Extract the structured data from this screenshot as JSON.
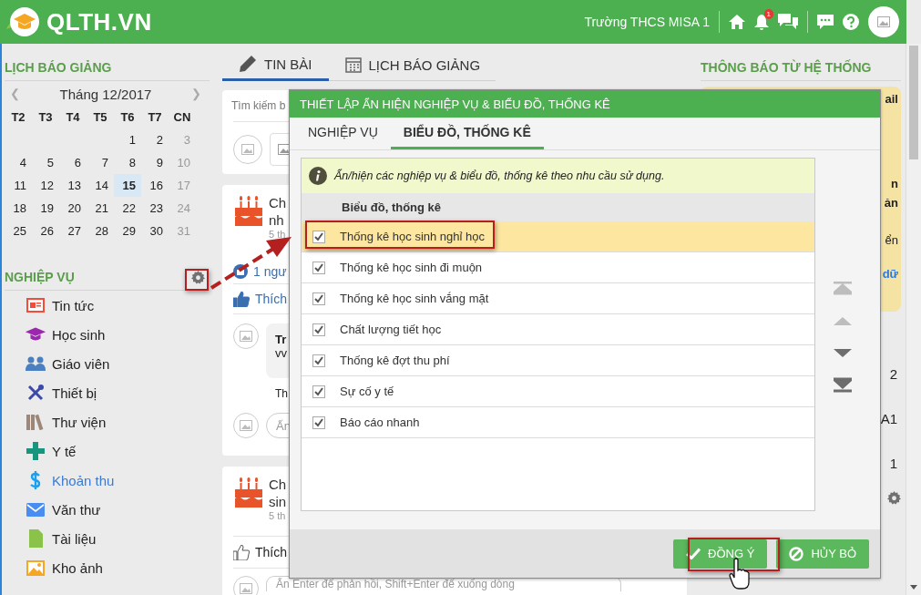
{
  "header": {
    "logo": "QLTH.VN",
    "school": "Trường THCS MISA 1",
    "badge": "1"
  },
  "calendar": {
    "title": "LỊCH BÁO GIẢNG",
    "month": "Tháng 12/2017",
    "prev": "❮",
    "next": "❯",
    "weekdays": [
      "T2",
      "T3",
      "T4",
      "T5",
      "T6",
      "T7",
      "CN"
    ],
    "weeks": [
      [
        {
          "day": "1",
          "selected": false
        },
        {
          "day": "2",
          "selected": false
        },
        {
          "day": "3",
          "selected": false
        }
      ],
      [
        {
          "day": "4",
          "selected": false
        },
        {
          "day": "5",
          "selected": false
        },
        {
          "day": "6",
          "selected": false
        },
        {
          "day": "7",
          "selected": false
        },
        {
          "day": "8",
          "selected": false
        },
        {
          "day": "9",
          "selected": false
        },
        {
          "day": "10",
          "selected": false
        }
      ],
      [
        {
          "day": "11",
          "selected": false
        },
        {
          "day": "12",
          "selected": false
        },
        {
          "day": "13",
          "selected": false
        },
        {
          "day": "14",
          "selected": false
        },
        {
          "day": "15",
          "selected": true
        },
        {
          "day": "16",
          "selected": false
        },
        {
          "day": "17",
          "selected": false
        }
      ],
      [
        {
          "day": "18",
          "selected": false
        },
        {
          "day": "19",
          "selected": false
        },
        {
          "day": "20",
          "selected": false
        },
        {
          "day": "21",
          "selected": false
        },
        {
          "day": "22",
          "selected": false
        },
        {
          "day": "23",
          "selected": false
        },
        {
          "day": "24",
          "selected": false
        }
      ],
      [
        {
          "day": "25",
          "selected": false
        },
        {
          "day": "26",
          "selected": false
        },
        {
          "day": "27",
          "selected": false
        },
        {
          "day": "28",
          "selected": false
        },
        {
          "day": "29",
          "selected": false
        },
        {
          "day": "30",
          "selected": false
        },
        {
          "day": "31",
          "selected": false
        }
      ]
    ]
  },
  "modules": {
    "title": "NGHIỆP VỤ",
    "items": [
      {
        "kind": "news",
        "label": "Tin tức",
        "selected": false
      },
      {
        "kind": "student",
        "label": "Học sinh",
        "selected": false
      },
      {
        "kind": "teacher",
        "label": "Giáo viên",
        "selected": false
      },
      {
        "kind": "equipment",
        "label": "Thiết bị",
        "selected": false
      },
      {
        "kind": "library",
        "label": "Thư viện",
        "selected": false
      },
      {
        "kind": "health",
        "label": "Y tế",
        "selected": false
      },
      {
        "kind": "fee",
        "label": "Khoản thu",
        "selected": true
      },
      {
        "kind": "mail",
        "label": "Văn thư",
        "selected": false
      },
      {
        "kind": "document",
        "label": "Tài liệu",
        "selected": false
      },
      {
        "kind": "photo",
        "label": "Kho ảnh",
        "selected": false
      }
    ]
  },
  "feed": {
    "tabs": [
      {
        "label": "TIN BÀI",
        "kind": "posts",
        "selected": true
      },
      {
        "label": "LỊCH BÁO GIẢNG",
        "kind": "calendar",
        "selected": false
      }
    ],
    "search": {
      "placeholder": "Tìm kiếm b"
    },
    "posts": [
      {
        "title_lines": [
          "Ch",
          "nh"
        ],
        "time": "5 th",
        "likes": "1 ngư",
        "like_label": "Thích",
        "liked": true,
        "comment": {
          "author": "Tr",
          "text": "vv"
        },
        "reply_fragment": "Th",
        "reply_placeholder": "Ấn"
      },
      {
        "title_lines": [
          "Ch",
          "sin"
        ],
        "time": "5 th",
        "like_label": "Thích",
        "liked": false,
        "reply_placeholder": "Ấn Enter để phản hồi, Shift+Enter để xuống dòng"
      }
    ]
  },
  "notices": {
    "title": "THÔNG BÁO TỪ HỆ THỐNG",
    "fragments": [
      {
        "text": "ail",
        "kind": "bold"
      },
      {
        "text": "n",
        "kind": "bold"
      },
      {
        "text": "ản",
        "kind": "bold"
      },
      {
        "text": "ển",
        "kind": "plain"
      },
      {
        "text": "dữ",
        "kind": "link"
      }
    ],
    "list_fragments": [
      "2",
      "A1",
      "1"
    ]
  },
  "dialog": {
    "title": "THIẾT LẬP ẨN HIỆN NGHIỆP VỤ & BIỂU ĐỒ, THỐNG KÊ",
    "tabs": [
      {
        "label": "NGHIỆP VỤ",
        "selected": false
      },
      {
        "label": "BIỂU ĐỒ, THỐNG KÊ",
        "selected": true
      }
    ],
    "info": "Ẩn/hiện các nghiệp vụ & biểu đồ, thống kê theo nhu cầu sử dụng.",
    "column": "Biểu đồ, thống kê",
    "rows": [
      {
        "label": "Thống kê học sinh nghỉ học",
        "checked": true,
        "selected": true
      },
      {
        "label": "Thống kê học sinh đi muộn",
        "checked": true,
        "selected": false
      },
      {
        "label": "Thống kê học sinh vắng mặt",
        "checked": true,
        "selected": false
      },
      {
        "label": "Chất lượng tiết học",
        "checked": true,
        "selected": false
      },
      {
        "label": "Thống kê đợt thu phí",
        "checked": true,
        "selected": false
      },
      {
        "label": "Sự cố y tế",
        "checked": true,
        "selected": false
      },
      {
        "label": "Báo cáo nhanh",
        "checked": true,
        "selected": false
      }
    ],
    "move_buttons": [
      {
        "kind": "top",
        "disabled": true
      },
      {
        "kind": "up",
        "disabled": true
      },
      {
        "kind": "down",
        "disabled": false
      },
      {
        "kind": "bottom",
        "disabled": false
      }
    ],
    "buttons": [
      {
        "kind": "ok",
        "label": "ĐỒNG Ý"
      },
      {
        "kind": "cancel",
        "label": "HỦY BỎ"
      }
    ]
  }
}
